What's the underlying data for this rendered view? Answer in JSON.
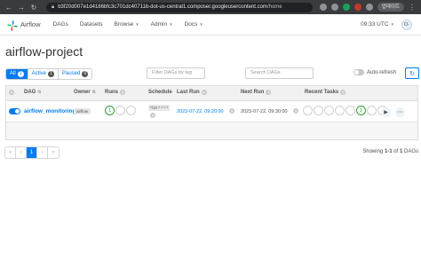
{
  "browser": {
    "url_host": "b3f20d007e1d4186bfc3c701dc40711b-dot-us-central1.composer.googleusercontent.com",
    "url_path": "/home",
    "profile_label": "업데이트"
  },
  "nav": {
    "logo_text": "Airflow",
    "menu": [
      {
        "label": "DAGs",
        "has_caret": false
      },
      {
        "label": "Datasets",
        "has_caret": false
      },
      {
        "label": "Browse",
        "has_caret": true
      },
      {
        "label": "Admin",
        "has_caret": true
      },
      {
        "label": "Docs",
        "has_caret": true
      }
    ],
    "time": "09:33 UTC",
    "user_initials": "O-"
  },
  "page": {
    "title": "airflow-project"
  },
  "filters": {
    "tabs": [
      {
        "label": "All",
        "count": "1"
      },
      {
        "label": "Active",
        "count": "1"
      },
      {
        "label": "Paused",
        "count": "0"
      }
    ],
    "tags_placeholder": "Filter DAGs by tag",
    "search_placeholder": "Search DAGs",
    "autorefresh_label": "Auto-refresh",
    "refresh_icon": "↻"
  },
  "table": {
    "headers": {
      "dag": "DAG",
      "owner": "Owner",
      "runs": "Runs",
      "schedule": "Schedule",
      "last_run": "Last Run",
      "next_run": "Next Run",
      "recent_tasks": "Recent Tasks",
      "sort_icon": "⇅",
      "help_icon": "?"
    },
    "rows": [
      {
        "dag_id": "airflow_monitoring",
        "owner": "airflow",
        "runs_success": "1",
        "schedule": "*/10 * * * *",
        "last_run": "2023-07-22, 09:20:00",
        "next_run": "2023-07-22, 09:30:00",
        "recent_tasks_success": "1"
      }
    ],
    "status_colors": {
      "success": "#2e9e3b",
      "accent": "#017cee"
    }
  },
  "pagination": {
    "first": "«",
    "prev": "‹",
    "current": "1",
    "next": "›",
    "last": "»",
    "showing_prefix": "Showing",
    "showing_range": "1-1",
    "showing_of": "of",
    "showing_total": "1",
    "showing_suffix": "DAGs"
  }
}
